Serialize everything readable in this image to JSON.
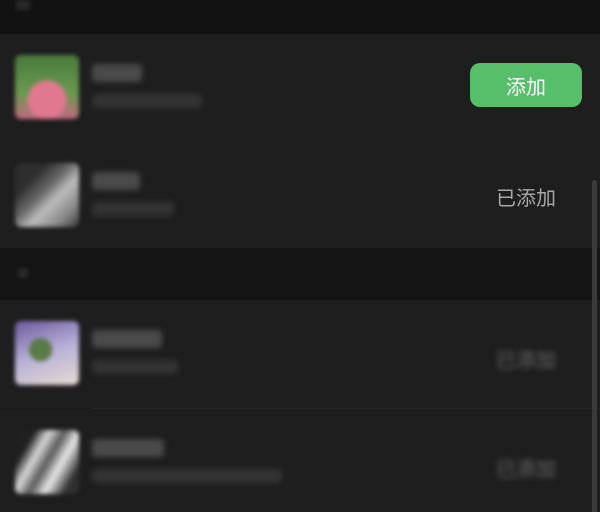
{
  "list": {
    "items": [
      {
        "status": "添加",
        "action_color": "#57be6a"
      },
      {
        "status": "已添加"
      },
      {
        "status": "已添加"
      },
      {
        "status": "已添加"
      }
    ]
  }
}
